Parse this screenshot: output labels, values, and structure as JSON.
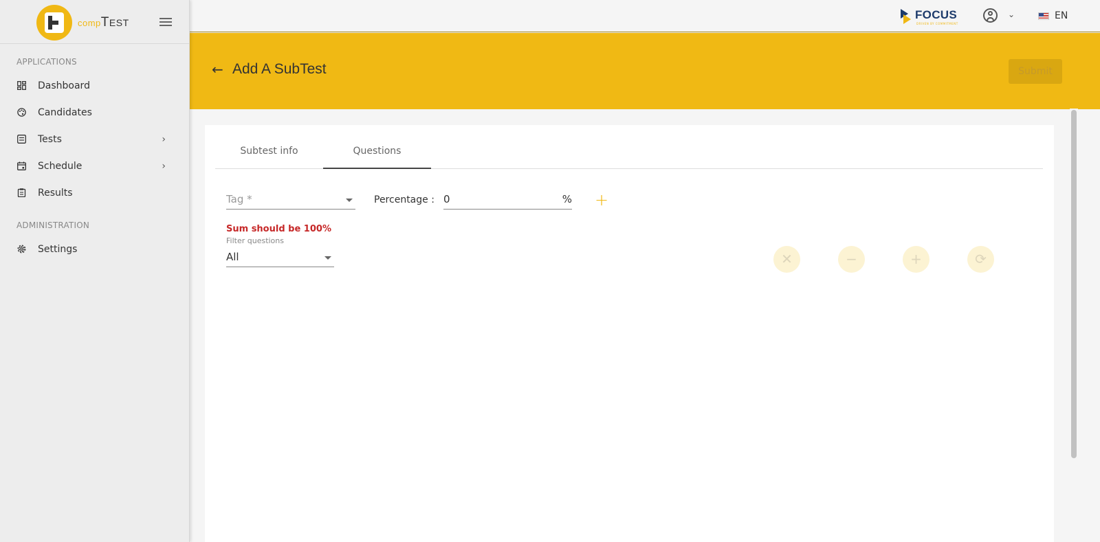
{
  "app": {
    "logo_comp": "comp",
    "logo_t": "T",
    "logo_est": "EST"
  },
  "sidebar": {
    "sections": [
      {
        "title": "APPLICATIONS"
      },
      {
        "title": "ADMINISTRATION"
      }
    ],
    "items": [
      {
        "label": "Dashboard",
        "icon": "dashboard-icon"
      },
      {
        "label": "Candidates",
        "icon": "palette-icon"
      },
      {
        "label": "Tests",
        "icon": "tests-icon",
        "has_submenu": true
      },
      {
        "label": "Schedule",
        "icon": "calendar-icon",
        "has_submenu": true
      },
      {
        "label": "Results",
        "icon": "clipboard-icon"
      },
      {
        "label": "Settings",
        "icon": "gear-icon"
      }
    ]
  },
  "topbar": {
    "brand": "FOCUS",
    "brand_tagline": "DRIVEN BY COMMITMENT",
    "language": "EN"
  },
  "header": {
    "title": "Add A SubTest",
    "submit_label": "Submit"
  },
  "tabs": [
    {
      "label": "Subtest info",
      "active": false
    },
    {
      "label": "Questions",
      "active": true
    }
  ],
  "form": {
    "tag_placeholder": "Tag *",
    "percentage_label": "Percentage :",
    "percentage_value": "0",
    "percentage_unit": "%",
    "add_symbol": "+",
    "error": "Sum should be 100%",
    "filter_label": "Filter questions",
    "filter_value": "All"
  },
  "actions": [
    {
      "name": "clear-button",
      "icon": "close-icon",
      "symbol": "✕"
    },
    {
      "name": "remove-button",
      "icon": "minus-icon",
      "symbol": "−"
    },
    {
      "name": "add-button",
      "icon": "plus-icon",
      "symbol": "+"
    },
    {
      "name": "refresh-button",
      "icon": "refresh-icon",
      "symbol": "⟳"
    }
  ],
  "colors": {
    "accent": "#f0b914",
    "error": "#c62828",
    "brand_blue": "#1d3b6b"
  }
}
